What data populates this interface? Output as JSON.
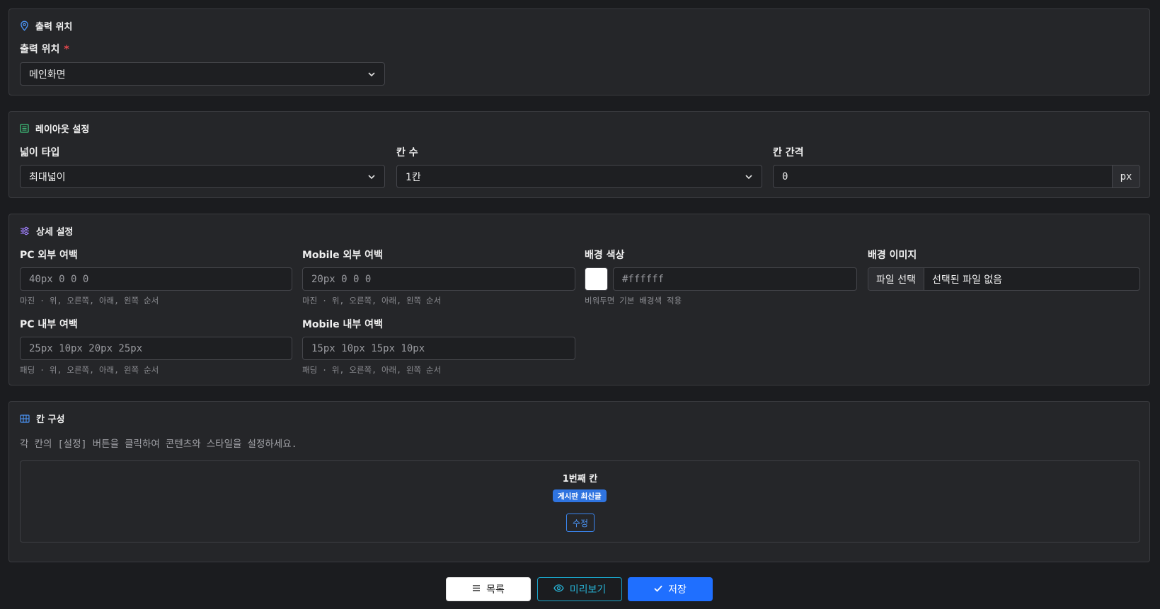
{
  "output_section": {
    "title": "출력 위치",
    "label": "출력 위치",
    "required_mark": "*",
    "select_value": "메인화면"
  },
  "layout_section": {
    "title": "레이아웃 설정",
    "width_type_label": "넓이 타입",
    "width_type_value": "최대넓이",
    "columns_label": "칸 수",
    "columns_value": "1칸",
    "gap_label": "칸 간격",
    "gap_value": "0",
    "gap_unit": "px"
  },
  "detail_section": {
    "title": "상세 설정",
    "pc_margin_label": "PC 외부 여백",
    "pc_margin_placeholder": "40px 0 0 0",
    "pc_margin_help": "마진 · 위, 오른쪽, 아래, 왼쪽 순서",
    "mobile_margin_label": "Mobile 외부 여백",
    "mobile_margin_placeholder": "20px 0 0 0",
    "mobile_margin_help": "마진 · 위, 오른쪽, 아래, 왼쪽 순서",
    "bg_color_label": "배경 색상",
    "bg_color_value": "#ffffff",
    "bg_color_placeholder": "#ffffff",
    "bg_color_help": "비워두면 기본 배경색 적용",
    "bg_image_label": "배경 이미지",
    "bg_image_button": "파일 선택",
    "bg_image_status": "선택된 파일 없음",
    "pc_padding_label": "PC 내부 여백",
    "pc_padding_placeholder": "25px 10px 20px 25px",
    "pc_padding_help": "패딩 · 위, 오른쪽, 아래, 왼쪽 순서",
    "mobile_padding_label": "Mobile 내부 여백",
    "mobile_padding_placeholder": "15px 10px 15px 10px",
    "mobile_padding_help": "패딩 · 위, 오른쪽, 아래, 왼쪽 순서"
  },
  "columns_section": {
    "title": "칸 구성",
    "description": "각 칸의 [설정] 버튼을 클릭하여 콘텐츠와 스타일을 설정하세요.",
    "columns": [
      {
        "title": "1번째 칸",
        "badge": "게시판 최신글",
        "edit_label": "수정"
      }
    ]
  },
  "footer": {
    "list_label": "목록",
    "preview_label": "미리보기",
    "save_label": "저장"
  },
  "colors": {
    "background": "#1b1c1f",
    "card": "#252629",
    "accent_blue": "#1f6fff",
    "accent_cyan": "#1aa5c9",
    "required_red": "#e5484d"
  }
}
